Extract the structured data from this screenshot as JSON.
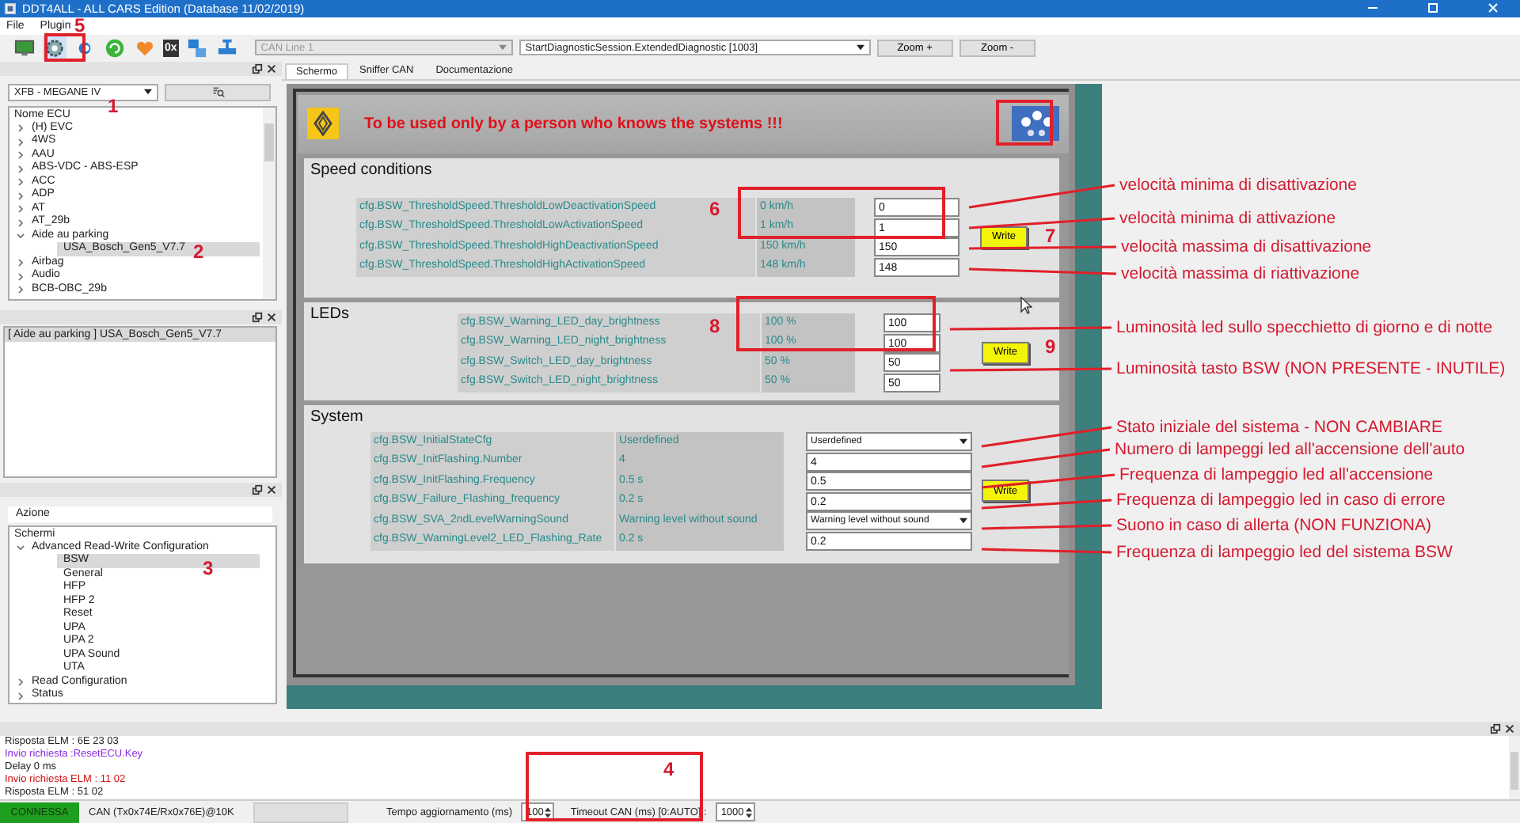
{
  "window": {
    "title": "DDT4ALL - ALL CARS Edition (Database 11/02/2019)"
  },
  "menu": [
    "File",
    "Plugin"
  ],
  "toolbar": {
    "hex_label": "0x",
    "can_line": {
      "value": "CAN Line 1",
      "disabled": true
    },
    "session": {
      "value": "StartDiagnosticSession.ExtendedDiagnostic [1003]",
      "disabled": false
    },
    "buttons": [
      "Zoom +",
      "Zoom -"
    ]
  },
  "ecu_panel": {
    "vehicle": "XFB - MEGANE IV",
    "tree_header": "Nome ECU",
    "items": [
      {
        "label": "(H) EVC",
        "expanded": false,
        "selected": false
      },
      {
        "label": "4WS",
        "expanded": false,
        "selected": false
      },
      {
        "label": "AAU",
        "expanded": false,
        "selected": false
      },
      {
        "label": "ABS-VDC - ABS-ESP",
        "expanded": false,
        "selected": false
      },
      {
        "label": "ACC",
        "expanded": false,
        "selected": false
      },
      {
        "label": "ADP",
        "expanded": false,
        "selected": false
      },
      {
        "label": "AT",
        "expanded": false,
        "selected": false
      },
      {
        "label": "AT_29b",
        "expanded": false,
        "selected": false
      },
      {
        "label": "Aide au parking",
        "expanded": true,
        "selected": false,
        "children": [
          {
            "label": "USA_Bosch_Gen5_V7.7",
            "selected": true
          }
        ]
      },
      {
        "label": "Airbag",
        "expanded": false,
        "selected": false
      },
      {
        "label": "Audio",
        "expanded": false,
        "selected": false
      },
      {
        "label": "BCB-OBC_29b",
        "expanded": false,
        "selected": false
      }
    ]
  },
  "selection_panel": {
    "items": [
      {
        "label": "[ Aide au parking ] USA_Bosch_Gen5_V7.7",
        "selected": true
      }
    ]
  },
  "action_panel": {
    "title": "Azione",
    "tree_header": "Schermi",
    "items": [
      {
        "label": "Advanced Read-Write Configuration",
        "expanded": true,
        "selected": false,
        "children": [
          {
            "label": "BSW",
            "selected": true
          },
          {
            "label": "General",
            "selected": false
          },
          {
            "label": "HFP",
            "selected": false
          },
          {
            "label": "HFP 2",
            "selected": false
          },
          {
            "label": "Reset",
            "selected": false
          },
          {
            "label": "UPA",
            "selected": false
          },
          {
            "label": "UPA 2",
            "selected": false
          },
          {
            "label": "UPA Sound",
            "selected": false
          },
          {
            "label": "UTA",
            "selected": false
          }
        ]
      },
      {
        "label": "Read Configuration",
        "expanded": false,
        "selected": false
      },
      {
        "label": "Status",
        "expanded": false,
        "selected": false
      }
    ]
  },
  "tabs": [
    {
      "label": "Schermo",
      "selected": true
    },
    {
      "label": "Sniffer CAN",
      "selected": false
    },
    {
      "label": "Documentazione",
      "selected": false
    }
  ],
  "screen": {
    "warning": "To be used only by a person who knows the systems !!!",
    "sections": [
      {
        "title": "Speed conditions",
        "write": "Write",
        "rows": [
          {
            "name": "cfg.BSW_ThresholdSpeed.ThresholdLowDeactivationSpeed",
            "reading": "0 km/h",
            "kind": "text",
            "value": "0"
          },
          {
            "name": "cfg.BSW_ThresholdSpeed.ThresholdLowActivationSpeed",
            "reading": "1 km/h",
            "kind": "text",
            "value": "1"
          },
          {
            "name": "cfg.BSW_ThresholdSpeed.ThresholdHighDeactivationSpeed",
            "reading": "150 km/h",
            "kind": "text",
            "value": "150"
          },
          {
            "name": "cfg.BSW_ThresholdSpeed.ThresholdHighActivationSpeed",
            "reading": "148 km/h",
            "kind": "text",
            "value": "148"
          }
        ]
      },
      {
        "title": "LEDs",
        "write": "Write",
        "rows": [
          {
            "name": "cfg.BSW_Warning_LED_day_brightness",
            "reading": "100 %",
            "kind": "text",
            "value": "100"
          },
          {
            "name": "cfg.BSW_Warning_LED_night_brightness",
            "reading": "100 %",
            "kind": "text",
            "value": "100"
          },
          {
            "name": "cfg.BSW_Switch_LED_day_brightness",
            "reading": "50 %",
            "kind": "text",
            "value": "50"
          },
          {
            "name": "cfg.BSW_Switch_LED_night_brightness",
            "reading": "50 %",
            "kind": "text",
            "value": "50"
          }
        ]
      },
      {
        "title": "System",
        "write": "Write",
        "rows": [
          {
            "name": "cfg.BSW_InitialStateCfg",
            "reading": "Userdefined",
            "kind": "select",
            "value": "Userdefined"
          },
          {
            "name": "cfg.BSW_InitFlashing.Number",
            "reading": "4",
            "kind": "text",
            "value": "4"
          },
          {
            "name": "cfg.BSW_InitFlashing.Frequency",
            "reading": "0.5 s",
            "kind": "text",
            "value": "0.5"
          },
          {
            "name": "cfg.BSW_Failure_Flashing_frequency",
            "reading": "0.2 s",
            "kind": "text",
            "value": "0.2"
          },
          {
            "name": "cfg.BSW_SVA_2ndLevelWarningSound",
            "reading": "Warning level without sound",
            "kind": "select",
            "value": "Warning level without sound"
          },
          {
            "name": "cfg.BSW_WarningLevel2_LED_Flashing_Rate",
            "reading": "0.2 s",
            "kind": "text",
            "value": "0.2"
          }
        ]
      }
    ]
  },
  "annotations": {
    "markers": [
      "1",
      "2",
      "3",
      "4",
      "5",
      "6",
      "7",
      "8",
      "9"
    ],
    "notes": [
      "velocità minima di disattivazione",
      "velocità minima di attivazione",
      "velocità massima di disattivazione",
      "velocità massima di riattivazione",
      "Luminosità led sullo specchietto di giorno e di notte",
      "Luminosità tasto BSW (NON PRESENTE - INUTILE)",
      "Stato iniziale del sistema - NON CAMBIARE",
      "Numero di lampeggi led all'accensione dell'auto",
      "Frequenza di lampeggio led all'accensione",
      "Frequenza di lampeggio led in caso di errore",
      "Suono in caso di allerta (NON FUNZIONA)",
      "Frequenza di lampeggio led del sistema BSW"
    ]
  },
  "log": [
    {
      "kind": "response",
      "text": "Risposta ELM : 6E 23 03"
    },
    {
      "kind": "request",
      "text": "Invio richiesta :ResetECU.Key"
    },
    {
      "kind": "info",
      "text": "Delay 0 ms"
    },
    {
      "kind": "elm_request",
      "text": "Invio richiesta ELM : 11 02"
    },
    {
      "kind": "response",
      "text": "Risposta ELM : 51 02"
    }
  ],
  "status_bar": {
    "connection": "CONNESSA",
    "connected": true,
    "can": "CAN (Tx0x74E/Rx0x76E)@10K",
    "refresh_label": "Tempo aggiornamento (ms)",
    "refresh": "100",
    "timeout_label": "Timeout CAN (ms) [0:AUTO] :",
    "timeout": "1000"
  }
}
